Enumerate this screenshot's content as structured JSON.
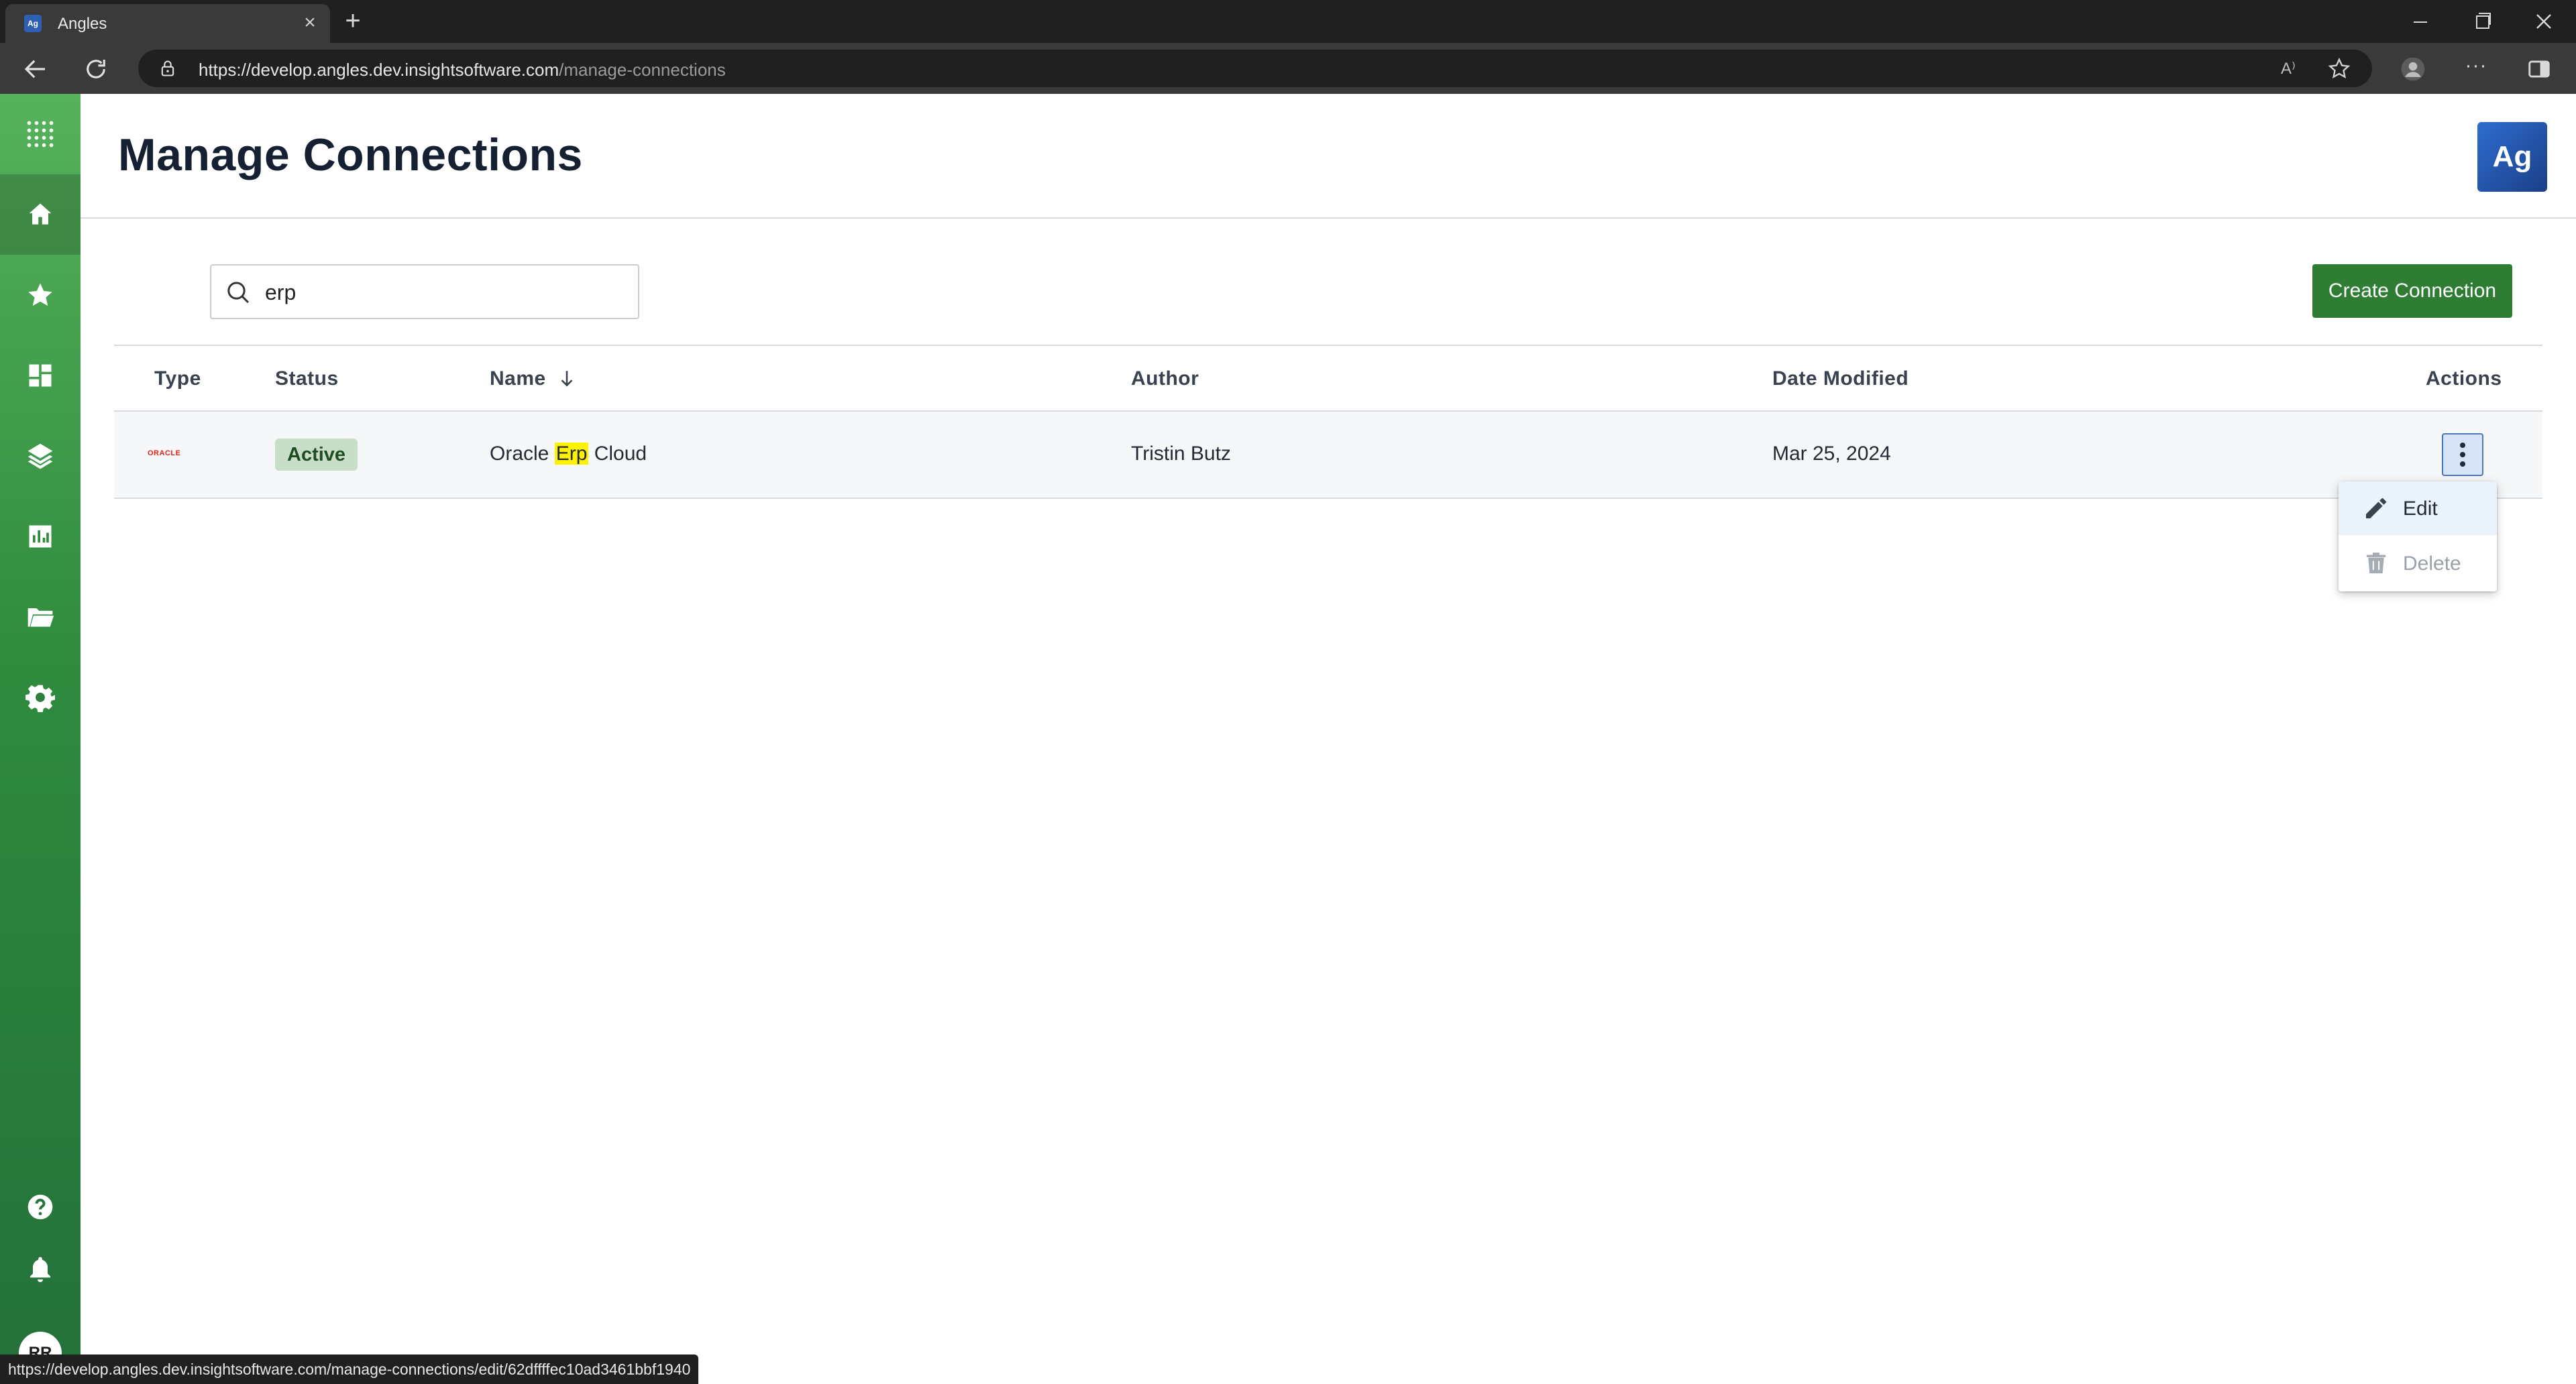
{
  "browser": {
    "tab_title": "Angles",
    "tab_favicon_text": "Ag",
    "url_host": "https://develop.angles.dev.insightsoftware.com",
    "url_path": "/manage-connections",
    "status_bar_url": "https://develop.angles.dev.insightsoftware.com/manage-connections/edit/62dffffec10ad3461bbf1940",
    "read_aloud_glyph": "A⁾"
  },
  "sidebar": {
    "items": [
      {
        "name": "apps-grid-icon"
      },
      {
        "name": "home-icon",
        "active": true
      },
      {
        "name": "favorites-star-icon"
      },
      {
        "name": "dashboard-icon"
      },
      {
        "name": "layers-icon"
      },
      {
        "name": "reports-chart-icon"
      },
      {
        "name": "folder-icon"
      },
      {
        "name": "settings-gear-icon"
      },
      {
        "name": "help-icon"
      },
      {
        "name": "notifications-bell-icon"
      }
    ],
    "user_initials": "RR"
  },
  "header": {
    "title": "Manage Connections",
    "logo_text": "Ag"
  },
  "search": {
    "value": "erp"
  },
  "toolbar": {
    "create_label": "Create Connection"
  },
  "table": {
    "columns": [
      "Type",
      "Status",
      "Name",
      "Author",
      "Date Modified",
      "Actions"
    ],
    "sort_column": "Name",
    "sort_direction": "desc",
    "rows": [
      {
        "type_logo_text": "ORACLE",
        "status": "Active",
        "name_before": "Oracle ",
        "name_highlight": "Erp",
        "name_after": " Cloud",
        "author": "Tristin Butz",
        "date_modified": "Mar 25, 2024"
      }
    ]
  },
  "actions_menu": {
    "items": [
      {
        "label": "Edit",
        "enabled": true
      },
      {
        "label": "Delete",
        "enabled": false
      }
    ]
  },
  "colors": {
    "sidebar_green_top": "#56b25b",
    "sidebar_green_bottom": "#23703a",
    "primary_button": "#2e7d32",
    "status_active_bg": "#c9dec9",
    "highlight": "#fff200",
    "oracle_red": "#e2231a"
  }
}
